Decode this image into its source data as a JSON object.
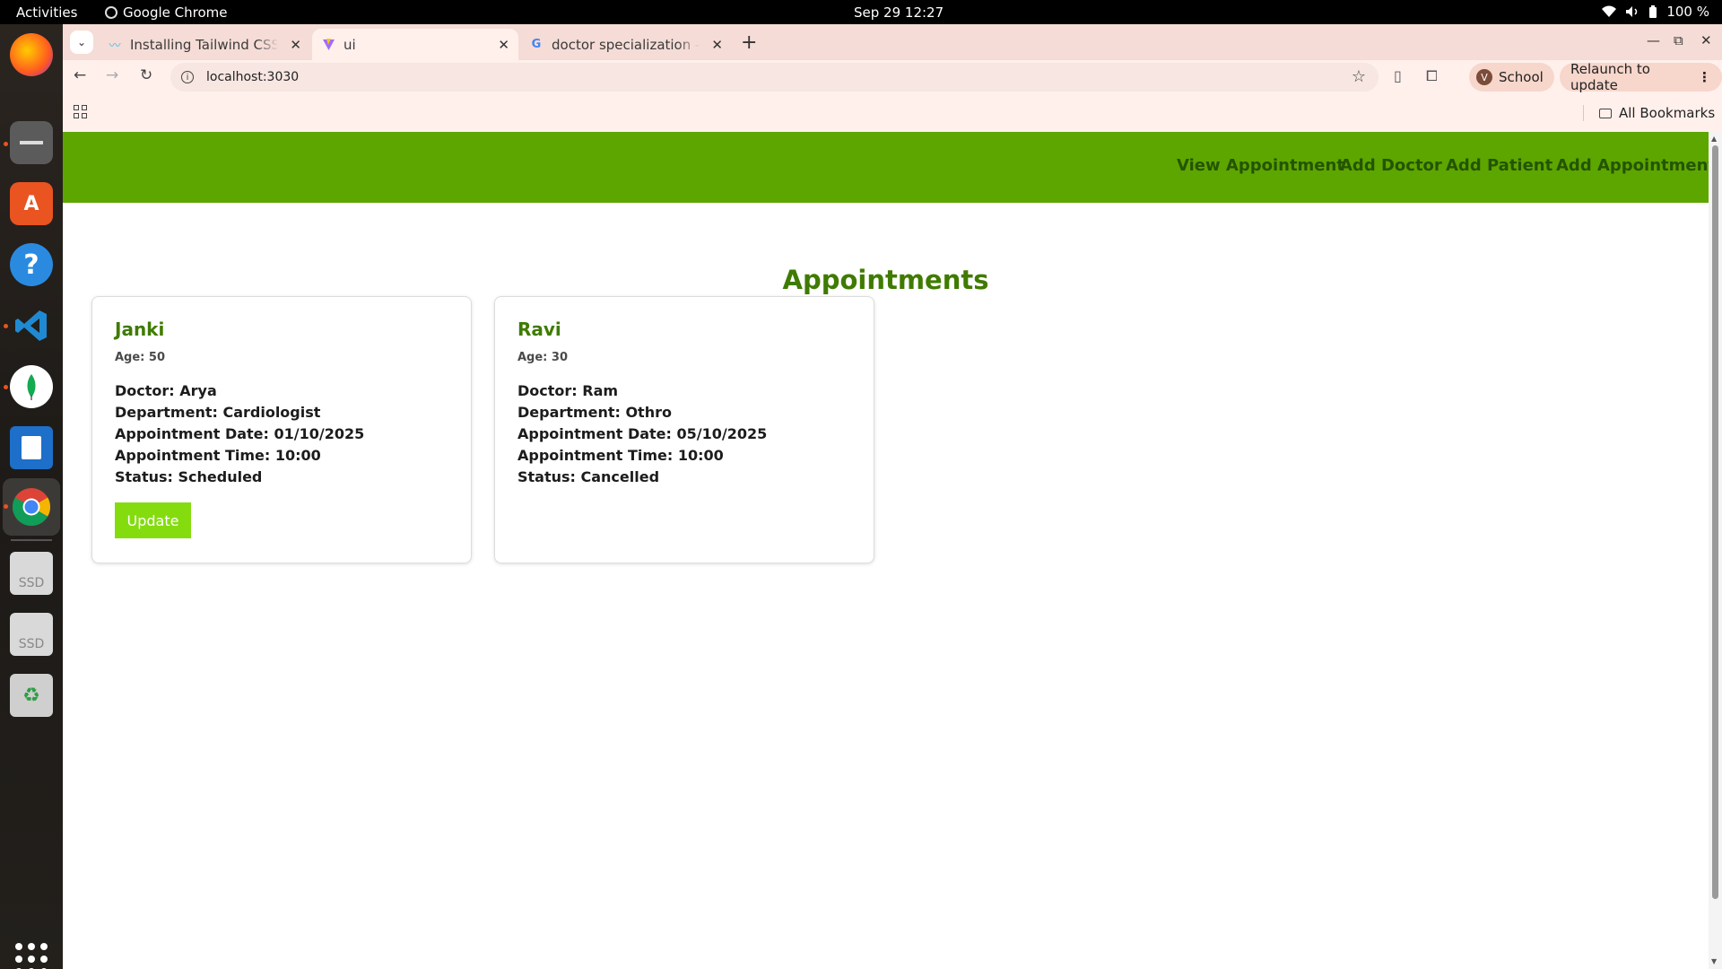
{
  "system": {
    "activities": "Activities",
    "app_name": "Google Chrome",
    "clock": "Sep 29  12:27",
    "battery": "100 %"
  },
  "dock": {
    "items": [
      "firefox-icon",
      "files-icon",
      "app-center-icon",
      "help-icon",
      "vscode-icon",
      "mongodb-compass-icon",
      "writer-icon",
      "chrome-icon",
      "ssd-drive-icon",
      "ssd-drive-icon",
      "trash-icon"
    ],
    "ssd_label": "SSD"
  },
  "browser": {
    "tabs": [
      {
        "title": "Installing Tailwind CSS w",
        "favicon": "tailwind-icon"
      },
      {
        "title": "ui",
        "favicon": "vite-icon",
        "active": true
      },
      {
        "title": "doctor specialization - G",
        "favicon": "google-icon"
      }
    ],
    "url": "localhost:3030",
    "profile_initial": "V",
    "profile_name": "School",
    "relaunch_label": "Relaunch to update",
    "all_bookmarks": "All Bookmarks"
  },
  "page": {
    "nav_links": [
      "View Appointment",
      "Add Doctor",
      "Add Patient",
      "Add Appointment"
    ],
    "heading": "Appointments",
    "appointments": [
      {
        "name": "Janki",
        "age": "Age: 50",
        "doctor": "Doctor: Arya",
        "department": "Department: Cardiologist",
        "date": "Appointment Date: 01/10/2025",
        "time": "Appointment Time: 10:00",
        "status": "Status: Scheduled",
        "update_label": "Update"
      },
      {
        "name": "Ravi",
        "age": "Age: 30",
        "doctor": "Doctor: Ram",
        "department": "Department: Othro",
        "date": "Appointment Date: 05/10/2025",
        "time": "Appointment Time: 10:00",
        "status": "Status: Cancelled"
      }
    ],
    "colors": {
      "navbar": "#5da600",
      "nav_link": "#255400",
      "heading": "#3f7b00",
      "update_button": "#84dc0f"
    }
  }
}
